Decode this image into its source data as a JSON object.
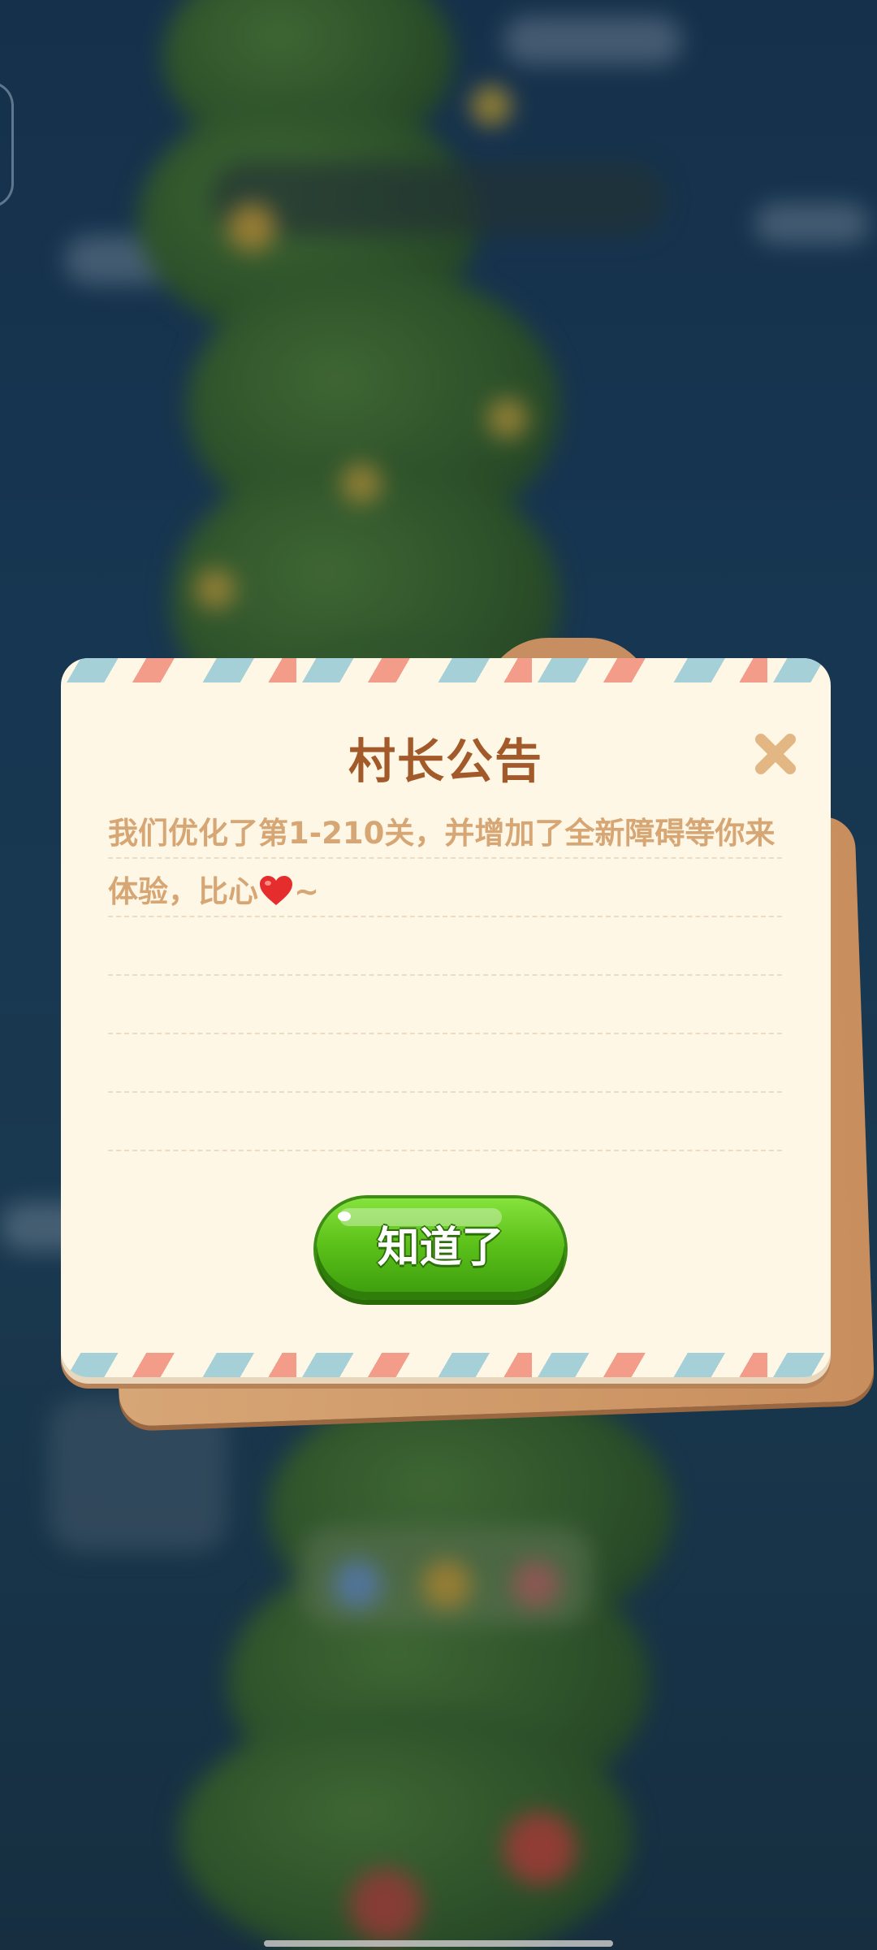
{
  "dialog": {
    "title": "村长公告",
    "message": "我们优化了第1-210关，并增加了全新障碍等你来体验，比心",
    "message_suffix": "~",
    "confirm_label": "知道了",
    "close_icon": "close-icon",
    "heart_icon": "heart-icon"
  },
  "colors": {
    "title": "#a35a2a",
    "message": "#d6a674",
    "button": "#5cc11a",
    "card": "#fff7e6"
  }
}
